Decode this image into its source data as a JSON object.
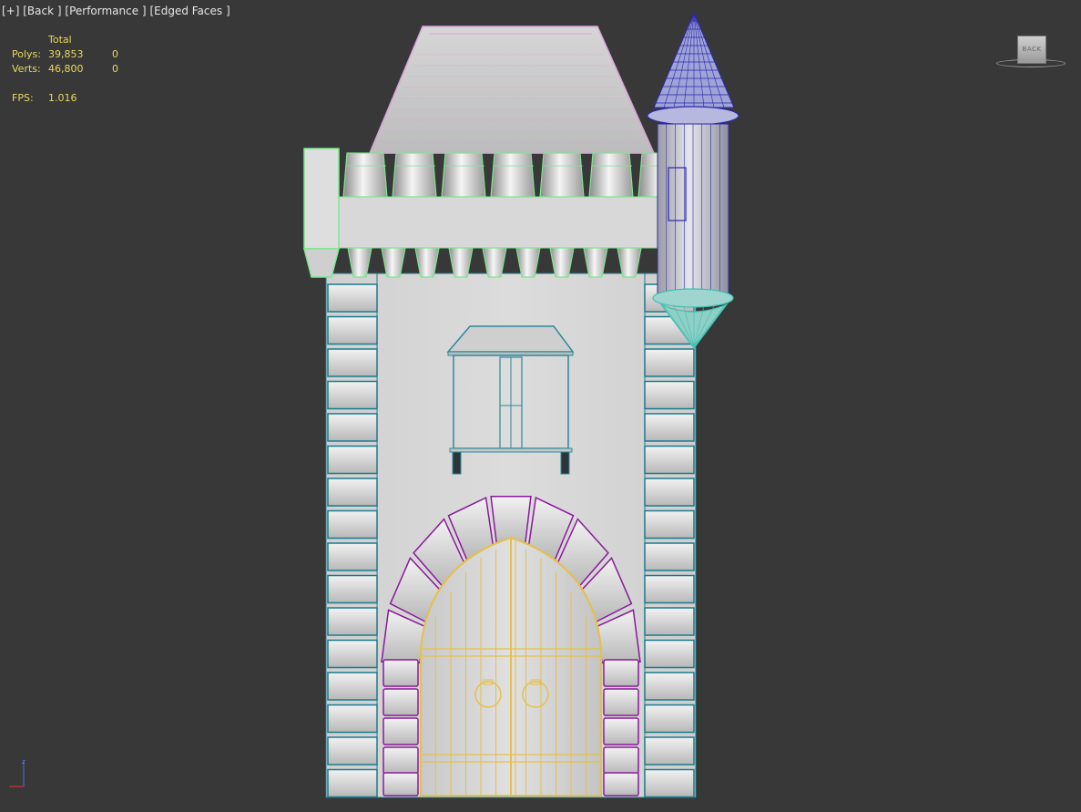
{
  "viewport": {
    "label_parts": [
      "[+]",
      "[Back ]",
      "[Performance ]",
      "[Edged Faces ]"
    ]
  },
  "stats": {
    "header": "Total",
    "polys_label": "Polys:",
    "polys_total": "39,853",
    "polys_selected": "0",
    "verts_label": "Verts:",
    "verts_total": "46,800",
    "verts_selected": "0",
    "fps_label": "FPS:",
    "fps_value": "1.016"
  },
  "viewcube": {
    "face_label": "BACK",
    "icon": "viewcube-icon"
  },
  "axis_gizmo": {
    "z_label": "z",
    "icon": "axis-tripod-icon"
  },
  "scene": {
    "object": "castle-tower-model",
    "colors": {
      "background": "#383838",
      "wall": "#d4d4d4",
      "stone_edges": "#1a7a8c",
      "battlement_edges": "#7be88e",
      "roof_edges": "#d9a3d6",
      "turret_edges": "#2a2aa8",
      "turret_base_edges": "#3ec0b0",
      "window_edges": "#2a8b9a",
      "arch_edges": "#8a1a9a",
      "door_edges": "#e6c04a"
    }
  }
}
